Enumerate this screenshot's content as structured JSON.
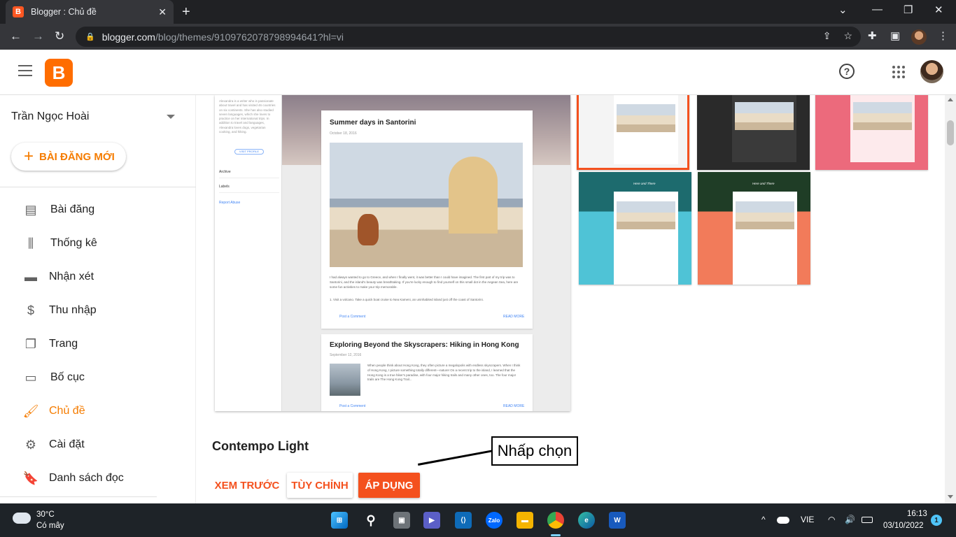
{
  "browser": {
    "tab_title": "Blogger : Chủ đề",
    "url_host": "blogger.com",
    "url_path": "/blog/themes/9109762078798994641?hl=vi"
  },
  "sidebar": {
    "blog_name": "Trần Ngọc Hoài",
    "new_post_label": "BÀI ĐĂNG MỚI",
    "items": [
      {
        "label": "Bài đăng",
        "icon": "posts-icon"
      },
      {
        "label": "Thống kê",
        "icon": "stats-icon"
      },
      {
        "label": "Nhận xét",
        "icon": "comments-icon"
      },
      {
        "label": "Thu nhập",
        "icon": "dollar-icon"
      },
      {
        "label": "Trang",
        "icon": "pages-icon"
      },
      {
        "label": "Bố cục",
        "icon": "layout-icon"
      },
      {
        "label": "Chủ đề",
        "icon": "paint-roller-icon",
        "active": true
      },
      {
        "label": "Cài đặt",
        "icon": "gear-icon"
      },
      {
        "label": "Danh sách đọc",
        "icon": "bookmark-icon"
      }
    ]
  },
  "preview": {
    "side_text": "Alexandra is a writer who is passionate about travel and has visited 46 countries on six continents. She has also studied seven languages, which she loves to practice on her international trips. In addition to travel and languages, Alexandra loves dogs, vegetarian cooking, and hiking.",
    "visit_profile": "VISIT PROFILE",
    "archive": "Archive",
    "labels": "Labels",
    "report_abuse": "Report Abuse",
    "post1_title": "Summer days in Santorini",
    "post1_date": "October 18, 2016",
    "post1_text": "I had always wanted to go to Greece, and when I finally went, it was better than I could have imagined. The first part of my trip was to Santorini, and the island's beauty was breathtaking. If you're lucky enough to find yourself on this small dot in the Aegean Sea, here are some fun activities to make your trip memorable.",
    "post1_text2": "1. Visit a volcano. Take a quick boat cruise to Nea Kameni, an uninhabited island just off the coast of Santorini.",
    "post_comment": "Post a Comment",
    "read_more": "READ MORE",
    "post2_title": "Exploring Beyond the Skyscrapers: Hiking in Hong Kong",
    "post2_date": "September 12, 2016",
    "post2_text": "When people think about Hong Kong, they often picture a megalopolis with endless skyscrapers. When I think of Hong Kong, I picture something totally different—nature! On a recent trip to the island, I learned that the Hong Kong is a true hiker's paradise, with four major hiking trails and many other ones, too. The four major trails are The Hong Kong Trail..."
  },
  "themes": [
    {
      "name": "orange-selected",
      "bg": "#f4f4f4",
      "border": "#f4511e"
    },
    {
      "name": "dark",
      "bg": "#2a2a2a",
      "border": ""
    },
    {
      "name": "pink",
      "bg": "#ec6a7c",
      "border": ""
    },
    {
      "name": "teal",
      "bg": "#4fc3d6",
      "border": "",
      "label": "Here and There"
    },
    {
      "name": "coral",
      "bg": "#f27b5a",
      "border": "",
      "label": "Here and There"
    }
  ],
  "theme_name": "Contempo Light",
  "buttons": {
    "preview": "XEM TRƯỚC",
    "customize": "TÙY CHỈNH",
    "apply": "ÁP DỤNG"
  },
  "annotation": "Nhấp chọn",
  "taskbar": {
    "temperature": "30°C",
    "weather": "Có mây",
    "language": "VIE",
    "time": "16:13",
    "date": "03/10/2022",
    "notifications": "1"
  }
}
